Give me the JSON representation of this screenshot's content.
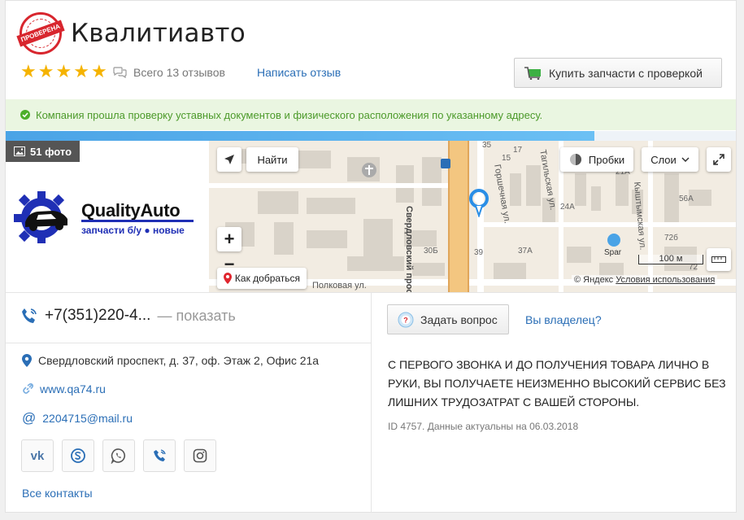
{
  "header": {
    "title": "Квалитиавто",
    "badge_text": "ПРОВЕРЕНА",
    "rating": 5,
    "reviews_text": "Всего 13 отзывов",
    "write_review_label": "Написать отзыв",
    "buy_button_label": "Купить запчасти с проверкой"
  },
  "verified_notice": "Компания прошла проверку уставных документов и физического расположения по указанному адресу.",
  "progress_fraction": 0.806,
  "media": {
    "photo_count_label": "51 фото",
    "logo_title": "QualityAuto",
    "logo_subtitle": "запчасти б/у ● новые"
  },
  "map": {
    "find_label": "Найти",
    "traffic_label": "Пробки",
    "layers_label": "Слои",
    "directions_label": "Как добраться",
    "scale_label": "100 м",
    "copyright": "© Яндекс",
    "terms_label": "Условия использования",
    "streets": {
      "sverdlovsky": "Свердловский просп.",
      "gorchechnaya": "Горшечная ул.",
      "tagilskaya": "Тагильская ул.",
      "kyshtymskaya": "Кыштымская ул.",
      "polovaya": "Полковая ул."
    },
    "labels": [
      "35",
      "17",
      "15",
      "21А",
      "24А",
      "56А",
      "72б",
      "72",
      "30Б",
      "39",
      "37А",
      "Spar"
    ]
  },
  "contacts": {
    "phone": "+7(351)220-4...",
    "show_label": "— показать",
    "address": "Свердловский проспект, д. 37, оф. Этаж 2, Офис 21а",
    "website": "www.qa74.ru",
    "email": "2204715@mail.ru",
    "all_contacts_label": "Все контакты"
  },
  "actions": {
    "ask_label": "Задать вопрос",
    "owner_label": "Вы владелец?"
  },
  "description": "С ПЕРВОГО ЗВОНКА И ДО ПОЛУЧЕНИЯ ТОВАРА ЛИЧНО В РУКИ, ВЫ ПОЛУЧАЕТЕ НЕИЗМЕННО ВЫСОКИЙ СЕРВИС БЕЗ ЛИШНИХ ТРУДОЗАТРАТ С ВАШЕЙ СТОРОНЫ.",
  "meta": "ID 4757. Данные актуальны на 06.03.2018",
  "colors": {
    "accent_link": "#2a6eb6",
    "star": "#f5b300",
    "verified_bg": "#eaf6e1",
    "verified_text": "#4c9a2a",
    "badge_red": "#d8262e",
    "logo_blue": "#1f2fb5"
  }
}
